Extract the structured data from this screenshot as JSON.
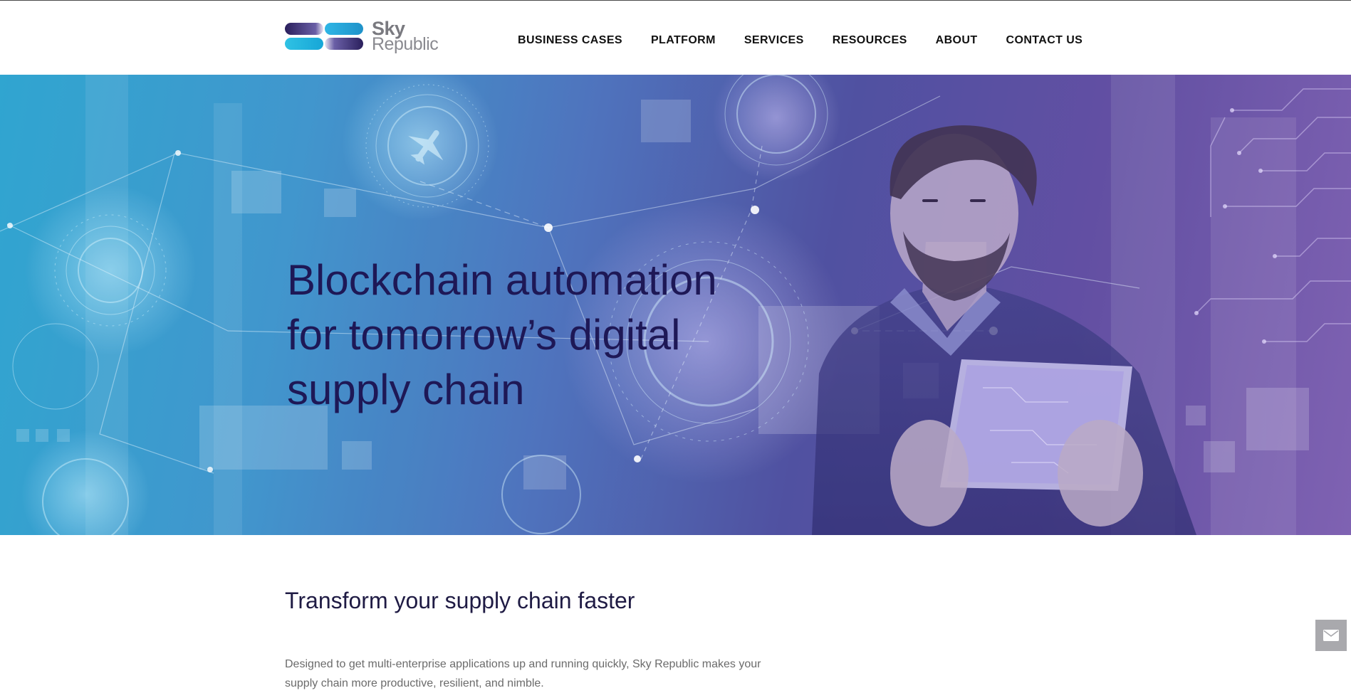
{
  "header": {
    "logo": {
      "line1": "Sky",
      "line2": "Republic"
    },
    "nav": [
      {
        "label": "BUSINESS CASES"
      },
      {
        "label": "PLATFORM"
      },
      {
        "label": "SERVICES"
      },
      {
        "label": "RESOURCES"
      },
      {
        "label": "ABOUT"
      },
      {
        "label": "CONTACT US"
      }
    ]
  },
  "hero": {
    "title": "Blockchain automation for tomorrow’s digital supply chain"
  },
  "intro": {
    "heading": "Transform your supply chain faster",
    "body": "Designed to get multi-enterprise applications up and running quickly, Sky Republic makes your supply chain more productive, resilient, and nimble."
  },
  "widgets": {
    "contact_icon": "envelope-icon"
  },
  "colors": {
    "hero_title": "#1e1856",
    "hero_left": "#2aa3cf",
    "hero_right": "#7b5db0",
    "nav_text": "#111111",
    "body_text": "#6b6b6b"
  }
}
